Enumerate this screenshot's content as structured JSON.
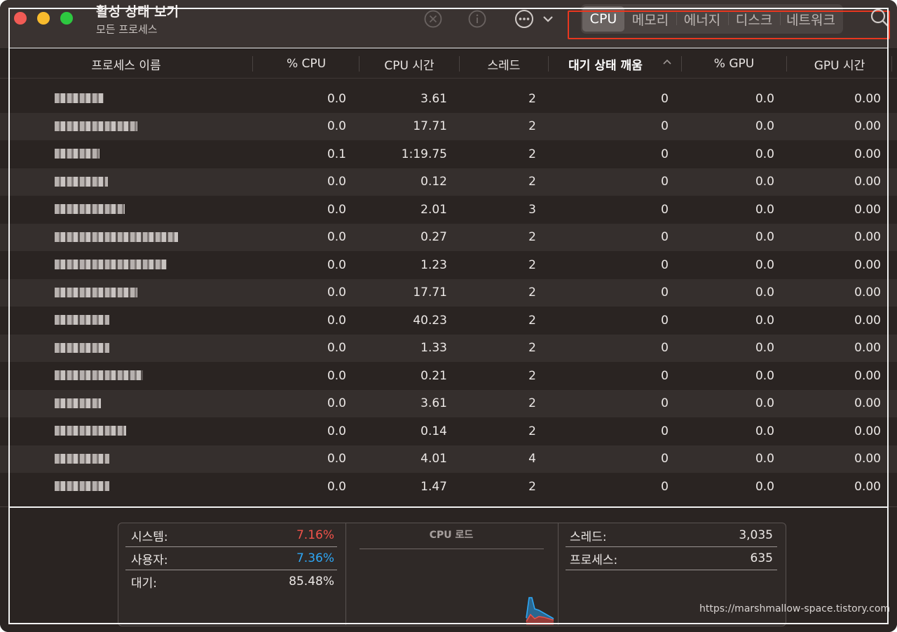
{
  "window": {
    "title": "활성 상태 보기",
    "subtitle": "모든 프로세스"
  },
  "toolbar": {
    "stop_icon": "x-circle-icon",
    "info_icon": "info-icon",
    "more_icon": "ellipsis-circle-icon",
    "tabs": [
      {
        "label": "CPU",
        "active": true
      },
      {
        "label": "메모리",
        "active": false
      },
      {
        "label": "에너지",
        "active": false
      },
      {
        "label": "디스크",
        "active": false
      },
      {
        "label": "네트워크",
        "active": false
      }
    ],
    "search_icon": "search-icon",
    "highlight_color": "#e8371f"
  },
  "columns": [
    {
      "label": "프로세스 이름"
    },
    {
      "label": "% CPU"
    },
    {
      "label": "CPU 시간"
    },
    {
      "label": "스레드"
    },
    {
      "label": "대기 상태 깨움",
      "sorted": true
    },
    {
      "label": "% GPU"
    },
    {
      "label": "GPU 시간"
    }
  ],
  "rows": [
    {
      "cpu": "0.0",
      "cpu_time": "3.61",
      "threads": "2",
      "wakeups": "0",
      "gpu": "0.0",
      "gpu_time": "0.00"
    },
    {
      "cpu": "0.0",
      "cpu_time": "17.71",
      "threads": "2",
      "wakeups": "0",
      "gpu": "0.0",
      "gpu_time": "0.00"
    },
    {
      "cpu": "0.1",
      "cpu_time": "1:19.75",
      "threads": "2",
      "wakeups": "0",
      "gpu": "0.0",
      "gpu_time": "0.00"
    },
    {
      "cpu": "0.0",
      "cpu_time": "0.12",
      "threads": "2",
      "wakeups": "0",
      "gpu": "0.0",
      "gpu_time": "0.00"
    },
    {
      "cpu": "0.0",
      "cpu_time": "2.01",
      "threads": "3",
      "wakeups": "0",
      "gpu": "0.0",
      "gpu_time": "0.00"
    },
    {
      "cpu": "0.0",
      "cpu_time": "0.27",
      "threads": "2",
      "wakeups": "0",
      "gpu": "0.0",
      "gpu_time": "0.00"
    },
    {
      "cpu": "0.0",
      "cpu_time": "1.23",
      "threads": "2",
      "wakeups": "0",
      "gpu": "0.0",
      "gpu_time": "0.00"
    },
    {
      "cpu": "0.0",
      "cpu_time": "17.71",
      "threads": "2",
      "wakeups": "0",
      "gpu": "0.0",
      "gpu_time": "0.00"
    },
    {
      "cpu": "0.0",
      "cpu_time": "40.23",
      "threads": "2",
      "wakeups": "0",
      "gpu": "0.0",
      "gpu_time": "0.00"
    },
    {
      "cpu": "0.0",
      "cpu_time": "1.33",
      "threads": "2",
      "wakeups": "0",
      "gpu": "0.0",
      "gpu_time": "0.00"
    },
    {
      "cpu": "0.0",
      "cpu_time": "0.21",
      "threads": "2",
      "wakeups": "0",
      "gpu": "0.0",
      "gpu_time": "0.00"
    },
    {
      "cpu": "0.0",
      "cpu_time": "3.61",
      "threads": "2",
      "wakeups": "0",
      "gpu": "0.0",
      "gpu_time": "0.00"
    },
    {
      "cpu": "0.0",
      "cpu_time": "0.14",
      "threads": "2",
      "wakeups": "0",
      "gpu": "0.0",
      "gpu_time": "0.00"
    },
    {
      "cpu": "0.0",
      "cpu_time": "4.01",
      "threads": "4",
      "wakeups": "0",
      "gpu": "0.0",
      "gpu_time": "0.00"
    },
    {
      "cpu": "0.0",
      "cpu_time": "1.47",
      "threads": "2",
      "wakeups": "0",
      "gpu": "0.0",
      "gpu_time": "0.00"
    }
  ],
  "summary": {
    "system_label": "시스템:",
    "system_value": "7.16%",
    "user_label": "사용자:",
    "user_value": "7.36%",
    "idle_label": "대기:",
    "idle_value": "85.48%",
    "cpu_load_title": "CPU 로드",
    "threads_label": "스레드:",
    "threads_value": "3,035",
    "processes_label": "프로세스:",
    "processes_value": "635",
    "system_color": "#f0524a",
    "user_color": "#2ea7f5"
  },
  "watermark": "https://marshmallow-space.tistory.com"
}
